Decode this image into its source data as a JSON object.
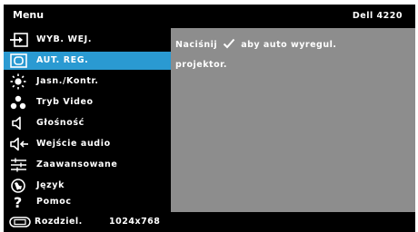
{
  "header": {
    "title": "Menu",
    "model": "Dell 4220"
  },
  "menu": {
    "items": [
      {
        "label": "WYB. WEJ.",
        "icon": "input-source-icon"
      },
      {
        "label": "AUT. REG.",
        "icon": "auto-adjust-icon",
        "selected": true
      },
      {
        "label": "Jasn./Kontr.",
        "icon": "brightness-icon"
      },
      {
        "label": "Tryb Video",
        "icon": "video-mode-icon"
      },
      {
        "label": "Głośność",
        "icon": "speaker-icon"
      },
      {
        "label": "Wejście audio",
        "icon": "audio-input-icon"
      },
      {
        "label": "Zaawansowane",
        "icon": "advanced-settings-icon"
      },
      {
        "label": "Język",
        "icon": "language-icon"
      },
      {
        "label": "Pomoc",
        "icon": "help-icon"
      }
    ]
  },
  "panel": {
    "line1_before": "Naciśnij",
    "line1_after": "aby auto wyregul.",
    "line2": "projektor."
  },
  "footer": {
    "label": "Rozdziel.",
    "value": "1024x768",
    "icon": "resolution-icon"
  },
  "colors": {
    "menu_bg": "#000000",
    "highlight": "#2a9ad2",
    "panel_bg": "#8d8d8d",
    "text": "#ffffff"
  }
}
